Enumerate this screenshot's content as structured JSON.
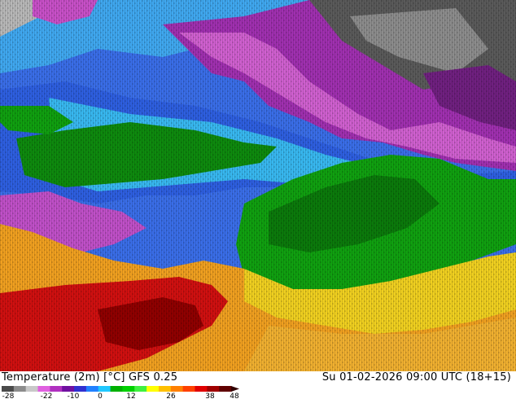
{
  "map": {
    "title": "Temperature (2m) [°C] GFS 0.25",
    "datetime": "Su 01-02-2026 09:00 UTC (18+15)",
    "legend": {
      "ticks": [
        "-28",
        "-22",
        "-10",
        "0",
        "12",
        "26",
        "38",
        "48"
      ],
      "colors": [
        "#4a4a4a",
        "#8c8c8c",
        "#c8c8c8",
        "#e060e0",
        "#b030c0",
        "#7010a0",
        "#3030d0",
        "#2080ff",
        "#20c8ff",
        "#00b000",
        "#00d000",
        "#40f040",
        "#ffff00",
        "#ffc000",
        "#ff8000",
        "#ff4000",
        "#e00000",
        "#a00000",
        "#600000"
      ]
    },
    "palette": {
      "darkgray": "#4a4a4a",
      "gray": "#8a8a8a",
      "purple": "#7a2a8a",
      "magenta": "#c848c8",
      "blue": "#3050e0",
      "lightblue": "#30c0f0",
      "darkgreen": "#107010",
      "green": "#10a010",
      "yellow": "#f0d010",
      "orange": "#f0a020",
      "red": "#d01010",
      "darkred": "#900000"
    }
  }
}
